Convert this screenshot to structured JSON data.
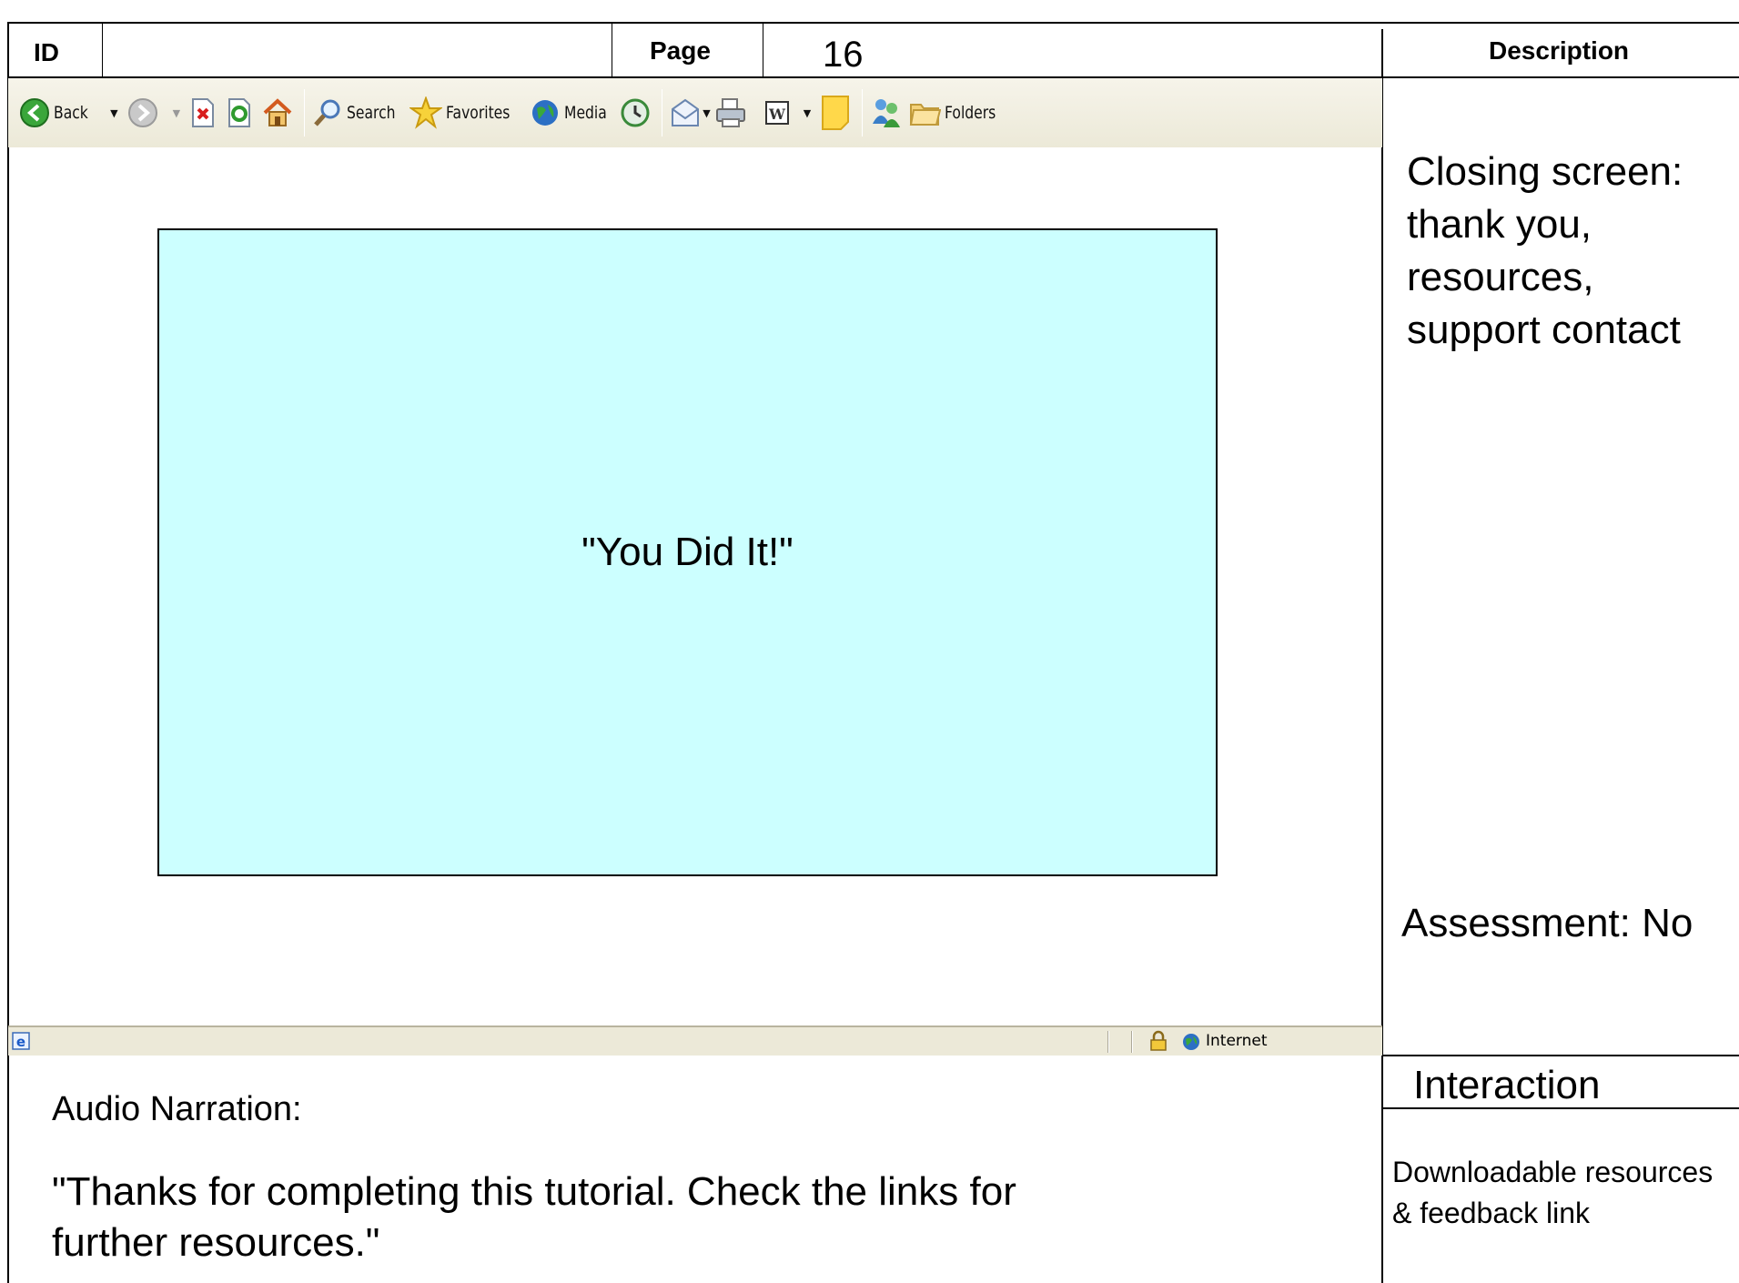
{
  "header": {
    "id_label": "ID",
    "page_label": "Page",
    "page_number": "16",
    "description_label": "Description"
  },
  "browser": {
    "toolbar": {
      "back_label": "Back",
      "search_label": "Search",
      "favorites_label": "Favorites",
      "media_label": "Media",
      "folders_label": "Folders"
    },
    "status": {
      "zone_label": "Internet"
    }
  },
  "screen": {
    "message": "\"You Did It!\"",
    "background": "#ccffff"
  },
  "description": {
    "text": "Closing screen: thank you, resources, support contact",
    "assessment": "Assessment: No"
  },
  "interaction": {
    "title": "Interaction",
    "text": "Downloadable resources & feedback link"
  },
  "audio": {
    "label": "Audio Narration:",
    "text": "\"Thanks for completing this tutorial. Check the links for further resources.\""
  }
}
